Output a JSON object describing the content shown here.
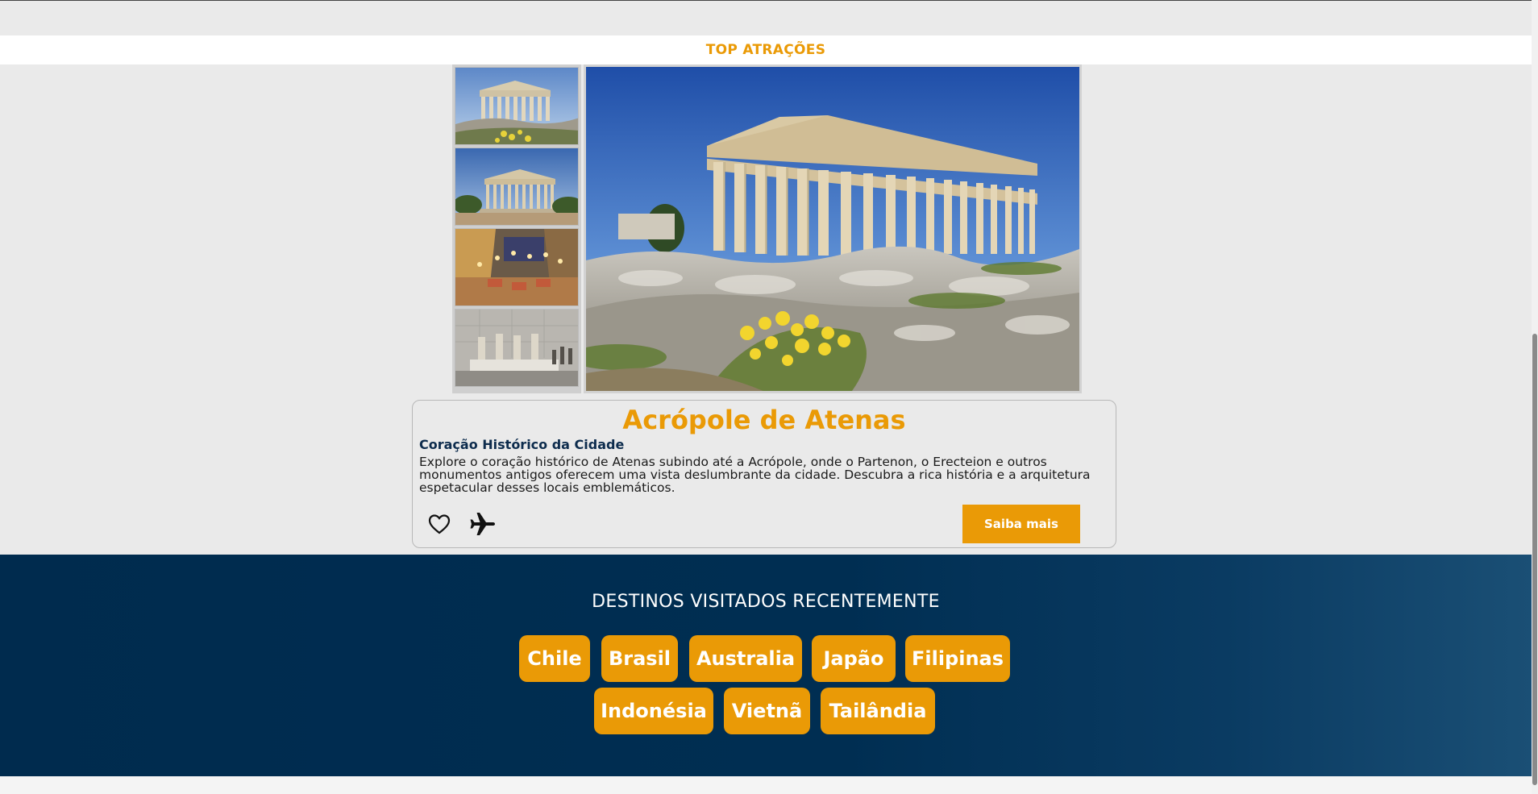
{
  "top_attractions": {
    "title": "TOP ATRAÇÕES"
  },
  "gallery": {
    "thumbnails": [
      {
        "icon": "parthenon-flowers-thumbnail"
      },
      {
        "icon": "hephaestus-temple-thumbnail"
      },
      {
        "icon": "plaka-night-street-thumbnail"
      },
      {
        "icon": "caryatids-museum-thumbnail"
      }
    ],
    "main_image": "parthenon-main-image"
  },
  "attraction": {
    "title": "Acrópole de Atenas",
    "subtitle": "Coração Histórico da Cidade",
    "description": "Explore o coração histórico de Atenas subindo até a Acrópole, onde o Partenon, o Erecteion e outros monumentos antigos oferecem uma vista deslumbrante da cidade. Descubra a rica história e a arquitetura espetacular desses locais emblemáticos.",
    "favorite_icon": "heart-icon",
    "travel_icon": "airplane-icon",
    "cta_label": "Saiba mais"
  },
  "recent": {
    "title": "DESTINOS VISITADOS RECENTEMENTE",
    "destinations": [
      "Chile",
      "Brasil",
      "Australia",
      "Japão",
      "Filipinas",
      "Indonésia",
      "Vietnã",
      "Tailândia"
    ]
  },
  "colors": {
    "accent": "#ea9a06",
    "navy": "#002e52",
    "subtitle": "#0d2c4d"
  }
}
